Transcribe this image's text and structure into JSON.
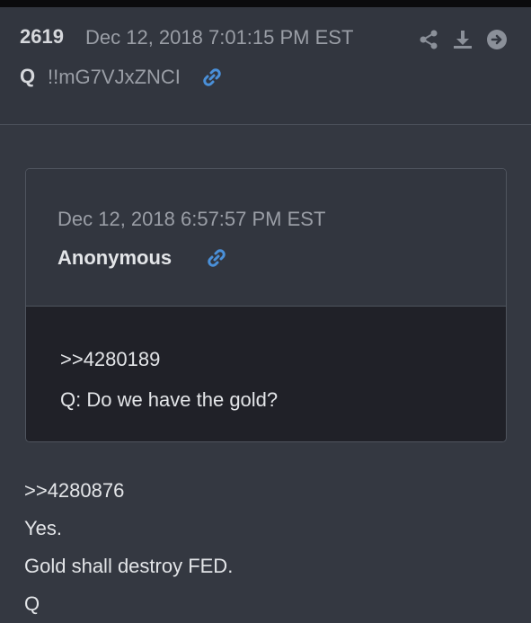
{
  "post": {
    "number": "2619",
    "date": "Dec 12, 2018 7:01:15 PM EST",
    "author": "Q",
    "tripcode": "!!mG7VJxZNCI"
  },
  "quoted_post": {
    "date": "Dec 12, 2018 6:57:57 PM EST",
    "author": "Anonymous",
    "lines": [
      ">>4280189",
      "Q: Do we have the gold?"
    ]
  },
  "message": {
    "lines": [
      ">>4280876",
      "Yes.",
      "Gold shall destroy FED.",
      "Q"
    ]
  },
  "icons": {
    "share": "share-icon",
    "download": "download-icon",
    "open": "arrow-right-circle-icon",
    "link": "link-icon"
  },
  "colors": {
    "background": "#32363f",
    "quote_body": "#202128",
    "link_blue": "#4a90d9",
    "muted_text": "#9a9ea6",
    "text": "#e3e5e8"
  }
}
